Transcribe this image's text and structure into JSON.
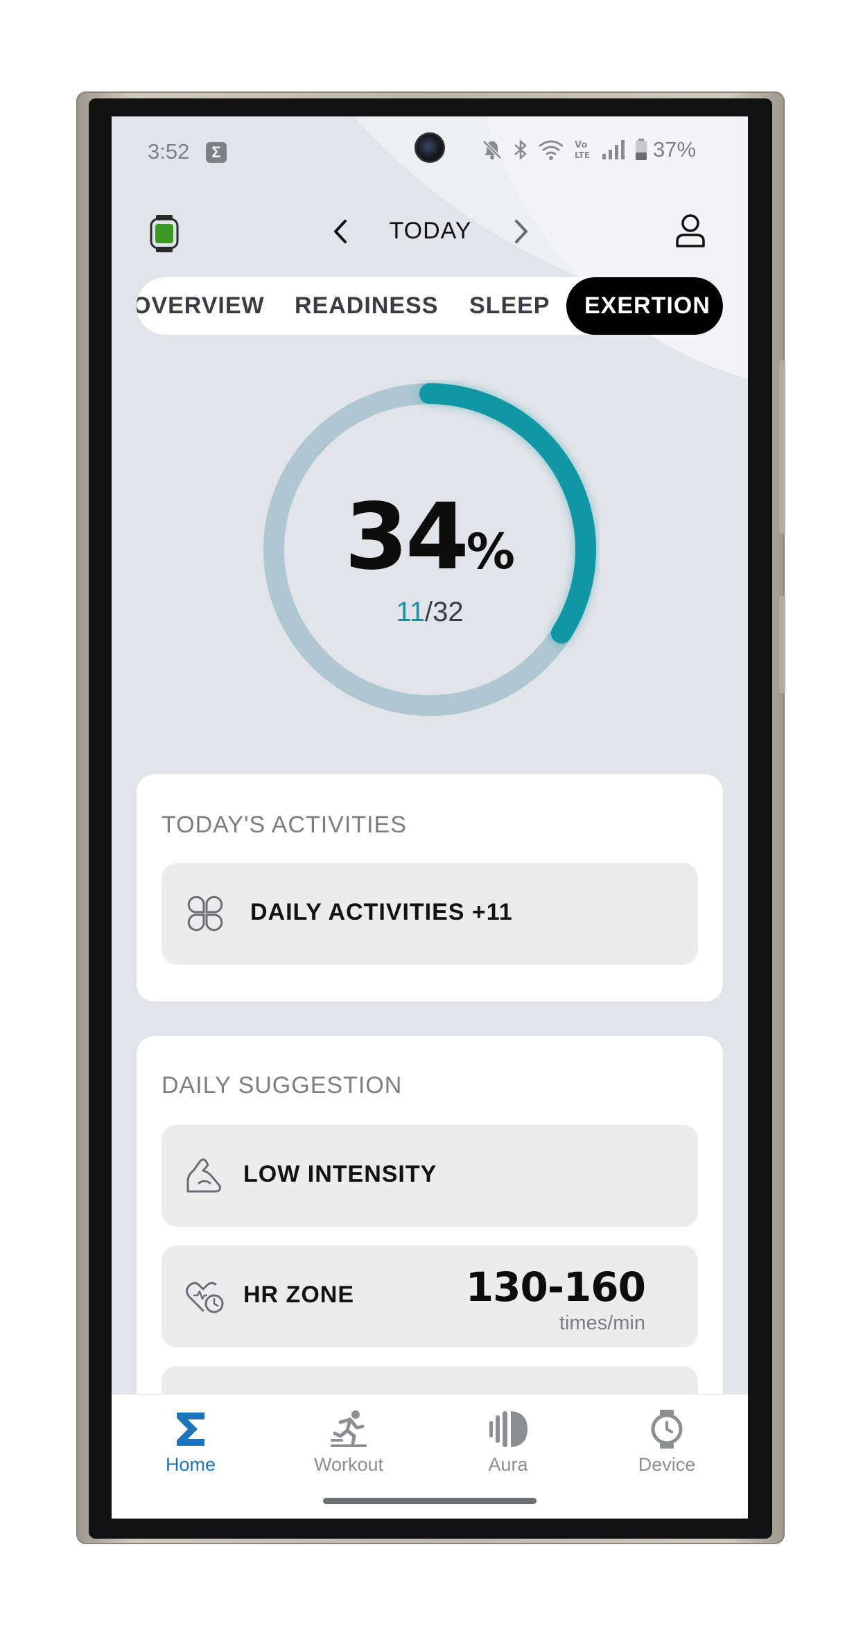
{
  "status_bar": {
    "time": "3:52",
    "app_badge": "Σ",
    "battery_percent": "37%",
    "icons": [
      "mute-icon",
      "bluetooth-icon",
      "wifi-icon",
      "volte-icon",
      "signal-icon",
      "battery-icon"
    ]
  },
  "header": {
    "date_label": "TODAY",
    "prev_icon": "chevron-left-icon",
    "next_icon": "chevron-right-icon",
    "watch_icon": "watch-icon",
    "profile_icon": "profile-icon"
  },
  "tabs": [
    {
      "label": "OVERVIEW",
      "active": false
    },
    {
      "label": "READINESS",
      "active": false
    },
    {
      "label": "SLEEP",
      "active": false
    },
    {
      "label": "EXERTION",
      "active": true
    }
  ],
  "exertion": {
    "percent": "34",
    "percent_sign": "%",
    "completed": "11",
    "separator": "/",
    "total": "32",
    "progress_fraction": 0.34,
    "track_color": "#aec7d1",
    "progress_color": "#0f97a3"
  },
  "todays_activities": {
    "title": "TODAY'S ACTIVITIES",
    "items": [
      {
        "icon": "apps-clover-icon",
        "label": "DAILY ACTIVITIES +11"
      }
    ]
  },
  "daily_suggestion": {
    "title": "DAILY SUGGESTION",
    "items": [
      {
        "icon": "arm-strength-icon",
        "label": "LOW INTENSITY"
      },
      {
        "icon": "heart-rate-icon",
        "label": "HR ZONE",
        "value": "130-160",
        "unit": "times/min"
      }
    ]
  },
  "bottom_nav": [
    {
      "label": "Home",
      "icon": "sigma-icon",
      "active": true
    },
    {
      "label": "Workout",
      "icon": "workout-icon",
      "active": false
    },
    {
      "label": "Aura",
      "icon": "aura-icon",
      "active": false
    },
    {
      "label": "Device",
      "icon": "device-watch-icon",
      "active": false
    }
  ],
  "colors": {
    "accent": "#0f97a3",
    "nav_active": "#1d74b8",
    "tab_active_bg": "#000000"
  }
}
